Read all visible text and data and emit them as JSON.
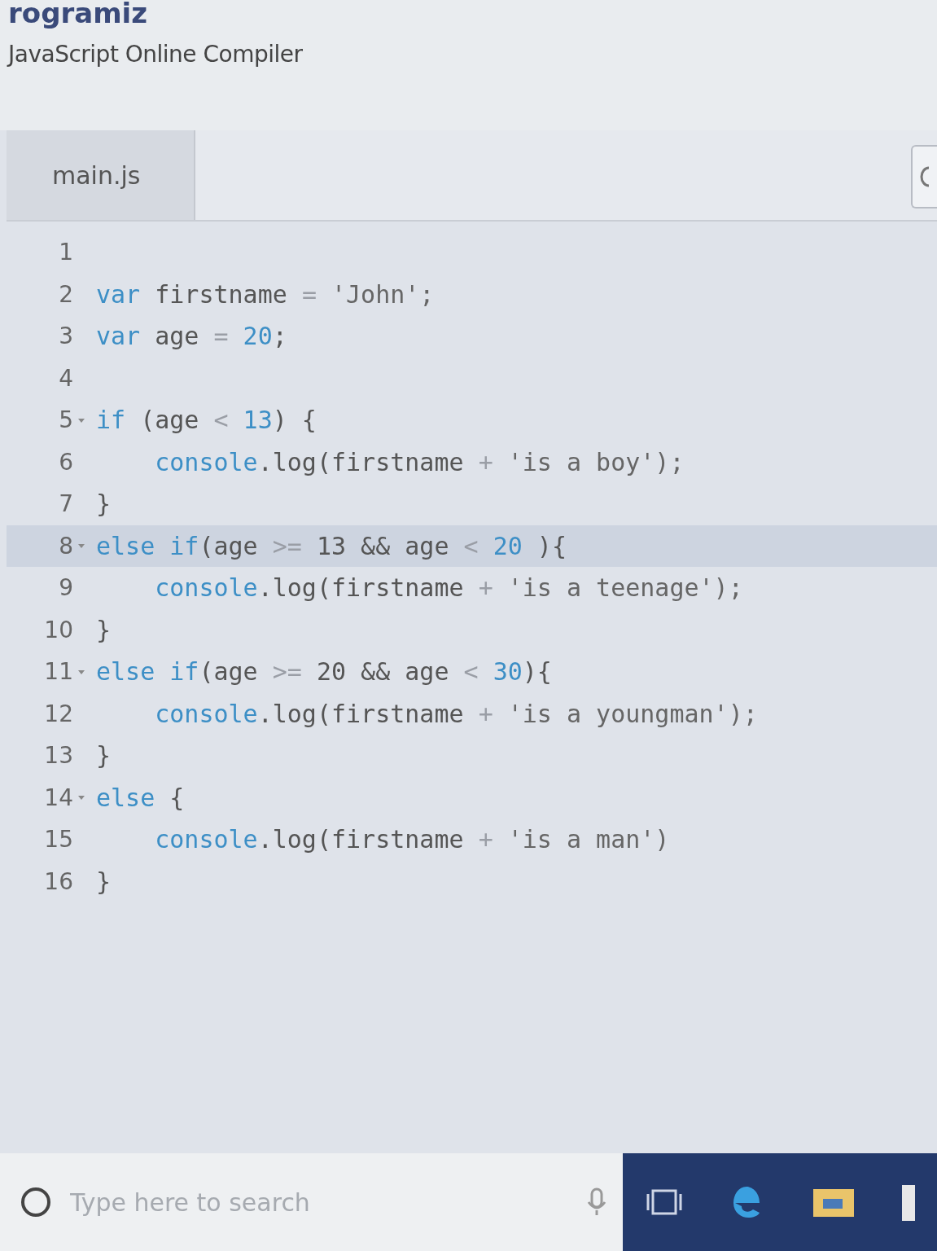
{
  "site": {
    "logo": "rogramiz",
    "subtitle": "JavaScript Online Compiler"
  },
  "tabs": [
    {
      "label": "main.js",
      "selected": true
    }
  ],
  "editor": {
    "lines": [
      {
        "number": "1",
        "foldable": false,
        "active": false
      },
      {
        "number": "2",
        "foldable": false,
        "active": false,
        "tokens": [
          {
            "text": "var",
            "kind": "keyword"
          },
          {
            "text": " firstname ",
            "kind": "plain"
          },
          {
            "text": "=",
            "kind": "operator"
          },
          {
            "text": " 'John';",
            "kind": "string"
          }
        ]
      },
      {
        "number": "3",
        "foldable": false,
        "active": false,
        "tokens": [
          {
            "text": "var",
            "kind": "keyword"
          },
          {
            "text": " age ",
            "kind": "plain"
          },
          {
            "text": "=",
            "kind": "operator"
          },
          {
            "text": " 20",
            "kind": "number"
          },
          {
            "text": ";",
            "kind": "plain"
          }
        ]
      },
      {
        "number": "4",
        "foldable": false,
        "active": false
      },
      {
        "number": "5",
        "foldable": true,
        "active": false,
        "tokens": [
          {
            "text": "if",
            "kind": "keyword"
          },
          {
            "text": " (age ",
            "kind": "plain"
          },
          {
            "text": "<",
            "kind": "operator"
          },
          {
            "text": " 13",
            "kind": "number"
          },
          {
            "text": ") {",
            "kind": "plain"
          }
        ]
      },
      {
        "number": "6",
        "foldable": false,
        "active": false,
        "tokens": [
          {
            "text": "    console",
            "kind": "keyword"
          },
          {
            "text": ".log(firstname ",
            "kind": "plain"
          },
          {
            "text": "+",
            "kind": "operator"
          },
          {
            "text": " 'is a boy');",
            "kind": "string"
          }
        ]
      },
      {
        "number": "7",
        "foldable": false,
        "active": false,
        "tokens": [
          {
            "text": "}",
            "kind": "plain"
          }
        ]
      },
      {
        "number": "8",
        "foldable": true,
        "active": true,
        "tokens": [
          {
            "text": "else if",
            "kind": "keyword"
          },
          {
            "text": "(age ",
            "kind": "plain"
          },
          {
            "text": ">=",
            "kind": "operator"
          },
          {
            "text": " 13 && age ",
            "kind": "plain"
          },
          {
            "text": "<",
            "kind": "operator"
          },
          {
            "text": " 20",
            "kind": "number"
          },
          {
            "text": " ){",
            "kind": "plain"
          }
        ]
      },
      {
        "number": "9",
        "foldable": false,
        "active": false,
        "tokens": [
          {
            "text": "    console",
            "kind": "keyword"
          },
          {
            "text": ".log(firstname ",
            "kind": "plain"
          },
          {
            "text": "+",
            "kind": "operator"
          },
          {
            "text": " 'is a teenage');",
            "kind": "string"
          }
        ]
      },
      {
        "number": "10",
        "foldable": false,
        "active": false,
        "tokens": [
          {
            "text": "}",
            "kind": "plain"
          }
        ]
      },
      {
        "number": "11",
        "foldable": true,
        "active": false,
        "tokens": [
          {
            "text": "else if",
            "kind": "keyword"
          },
          {
            "text": "(age ",
            "kind": "plain"
          },
          {
            "text": ">=",
            "kind": "operator"
          },
          {
            "text": " 20 && age ",
            "kind": "plain"
          },
          {
            "text": "<",
            "kind": "operator"
          },
          {
            "text": " 30",
            "kind": "number"
          },
          {
            "text": "){",
            "kind": "plain"
          }
        ]
      },
      {
        "number": "12",
        "foldable": false,
        "active": false,
        "tokens": [
          {
            "text": "    console",
            "kind": "keyword"
          },
          {
            "text": ".log(firstname ",
            "kind": "plain"
          },
          {
            "text": "+",
            "kind": "operator"
          },
          {
            "text": " 'is a youngman');",
            "kind": "string"
          }
        ]
      },
      {
        "number": "13",
        "foldable": false,
        "active": false,
        "tokens": [
          {
            "text": "}",
            "kind": "plain"
          }
        ]
      },
      {
        "number": "14",
        "foldable": true,
        "active": false,
        "tokens": [
          {
            "text": "else",
            "kind": "keyword"
          },
          {
            "text": " {",
            "kind": "plain"
          }
        ]
      },
      {
        "number": "15",
        "foldable": false,
        "active": false,
        "tokens": [
          {
            "text": "    console",
            "kind": "keyword"
          },
          {
            "text": ".log(firstname ",
            "kind": "plain"
          },
          {
            "text": "+",
            "kind": "operator"
          },
          {
            "text": " 'is a man')",
            "kind": "string"
          }
        ]
      },
      {
        "number": "16",
        "foldable": false,
        "active": false,
        "tokens": [
          {
            "text": "}",
            "kind": "plain"
          }
        ]
      }
    ]
  },
  "taskbar": {
    "search": {
      "placeholder": "Type here to search"
    }
  }
}
